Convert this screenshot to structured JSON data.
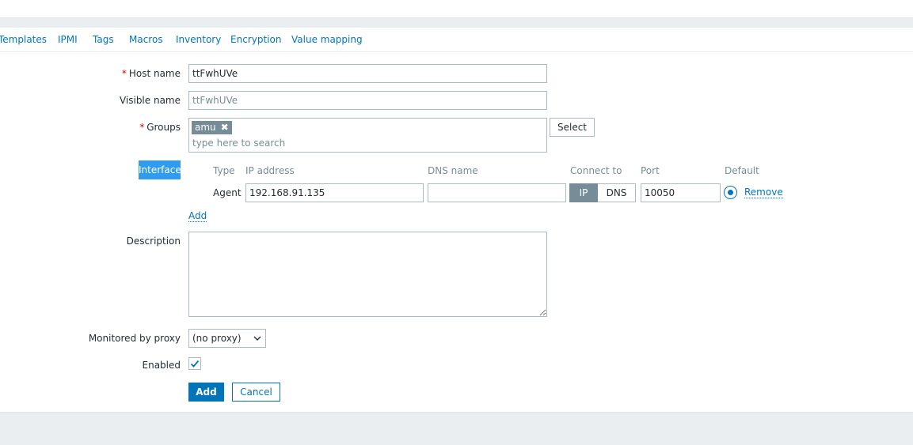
{
  "tabs": [
    "Templates",
    "IPMI",
    "Tags",
    "Macros",
    "Inventory",
    "Encryption",
    "Value mapping"
  ],
  "form": {
    "host_name": {
      "label": "Host name",
      "required_mark": "*",
      "value": "ttFwhUVe"
    },
    "visible_name": {
      "label": "Visible name",
      "placeholder": "ttFwhUVe"
    },
    "groups": {
      "label": "Groups",
      "required_mark": "*",
      "chips": [
        "amu"
      ],
      "remove_glyph": "✖",
      "placeholder": "type here to search",
      "select_label": "Select"
    },
    "interfaces": {
      "label": "Interfaces",
      "headers": {
        "type": "Type",
        "ip": "IP address",
        "dns": "DNS name",
        "connect_to": "Connect to",
        "port": "Port",
        "default": "Default"
      },
      "rows": [
        {
          "type": "Agent",
          "ip": "192.168.91.135",
          "dns": "",
          "connect_options": [
            "IP",
            "DNS"
          ],
          "connect_selected": "IP",
          "port": "10050",
          "default": true,
          "remove_label": "Remove"
        }
      ],
      "add_label": "Add"
    },
    "description": {
      "label": "Description",
      "value": ""
    },
    "proxy": {
      "label": "Monitored by proxy",
      "selected": "(no proxy)"
    },
    "enabled": {
      "label": "Enabled",
      "checked": true
    },
    "buttons": {
      "add": "Add",
      "cancel": "Cancel"
    }
  },
  "colors": {
    "accent": "#0275b8",
    "highlight": "#2f9cf1",
    "required": "#d40000",
    "chip": "#768d99"
  }
}
